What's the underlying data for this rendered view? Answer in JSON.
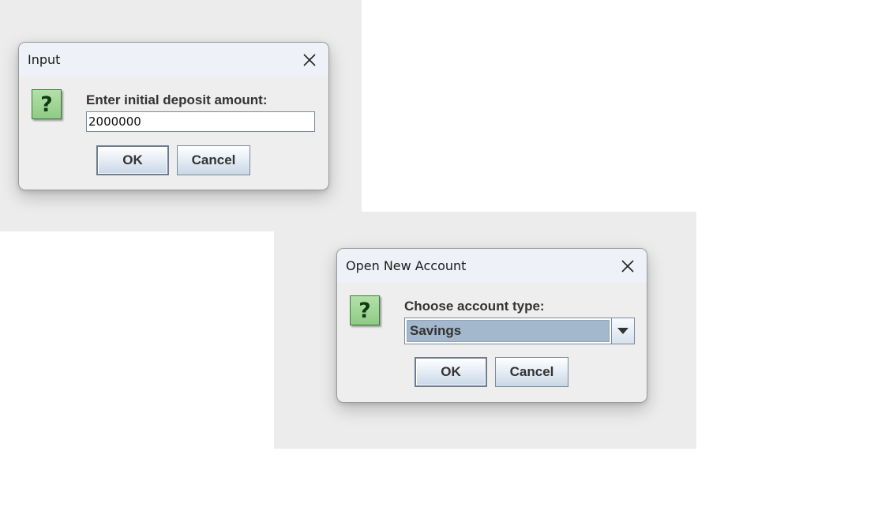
{
  "dialogs": {
    "deposit": {
      "title": "Input",
      "prompt": "Enter initial deposit amount:",
      "input_value": "2000000",
      "ok_label": "OK",
      "cancel_label": "Cancel",
      "icon": "question-icon",
      "icon_glyph": "?"
    },
    "account": {
      "title": "Open New Account",
      "prompt": "Choose account type:",
      "selected_type": "Savings",
      "ok_label": "OK",
      "cancel_label": "Cancel",
      "icon": "question-icon",
      "icon_glyph": "?"
    }
  },
  "colors": {
    "titlebar": "#eef1f8",
    "dialog_body": "#eeeeee",
    "combo_selection": "#a3b8cc",
    "icon_green": "#8fcc85"
  }
}
